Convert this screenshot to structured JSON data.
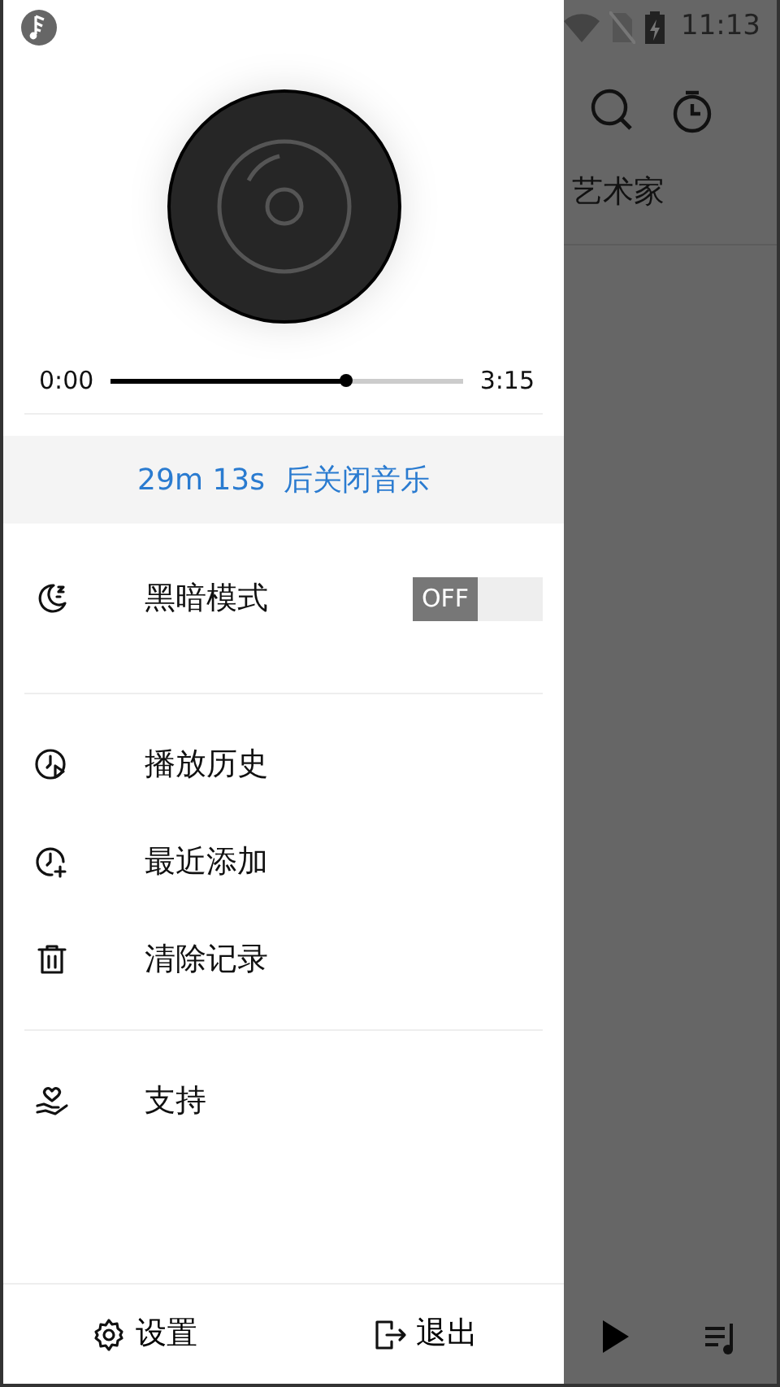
{
  "status_bar": {
    "time": "11:13"
  },
  "player": {
    "position": "0:00",
    "duration": "3:15",
    "level": 0.67
  },
  "sleep_timer": {
    "text": "29m 13s  后关闭音乐"
  },
  "dark_mode": {
    "label": "黑暗模式",
    "toggle_label": "OFF",
    "on": false
  },
  "menu_groups": [
    [
      {
        "label": "播放历史",
        "kind": "history"
      },
      {
        "label": "最近添加",
        "kind": "recent"
      },
      {
        "label": "清除记录",
        "kind": "clear"
      }
    ],
    [
      {
        "label": "支持",
        "kind": "support"
      }
    ]
  ],
  "footer": [
    {
      "label": "设置",
      "kind": "settings"
    },
    {
      "label": "退出",
      "kind": "exit"
    }
  ],
  "background": {
    "tab": "艺术家"
  }
}
